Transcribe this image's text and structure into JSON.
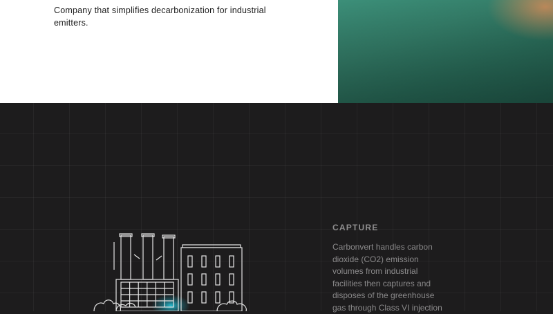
{
  "intro": {
    "text": "Company that simplifies decarbonization for industrial emitters."
  },
  "photo": {
    "description_icon": "aerial-landscape-photo"
  },
  "capture": {
    "heading": "CAPTURE",
    "body": "Carbonvert handles carbon dioxide (CO2) emission volumes from industrial facilities then captures and disposes of the greenhouse gas through Class VI injection"
  },
  "colors": {
    "dark_bg": "#1d1c1d",
    "line_art": "#e6e6e6",
    "accent_glow": "#28c4d8"
  },
  "illustration": {
    "icon": "factory-icon"
  }
}
